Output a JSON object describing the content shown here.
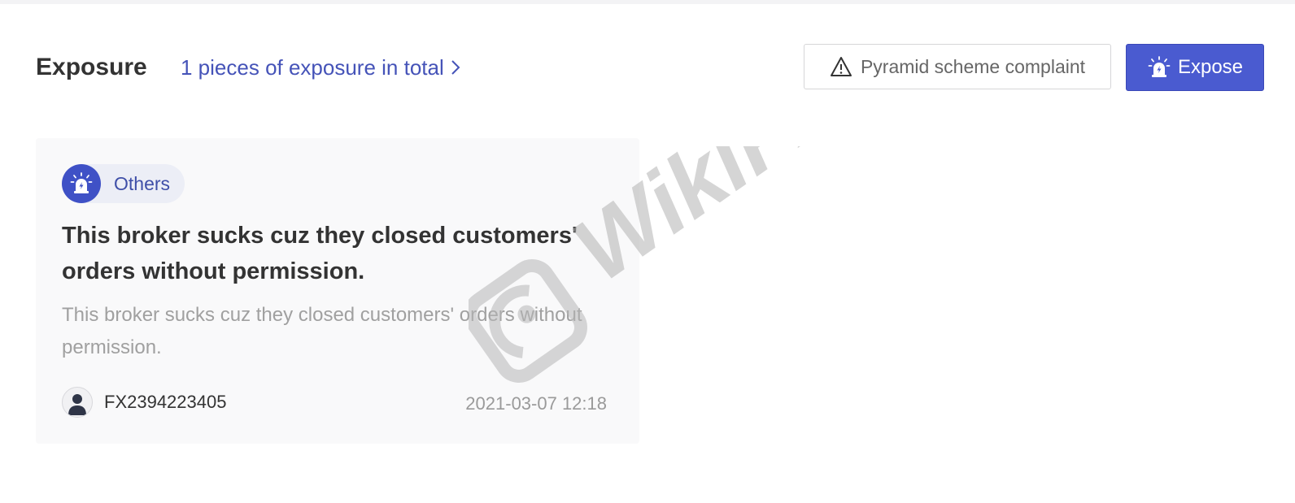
{
  "header": {
    "title": "Exposure",
    "total_link": "1 pieces of exposure in total",
    "complaint_button": "Pyramid scheme complaint",
    "expose_button": "Expose"
  },
  "card": {
    "tag": "Others",
    "title": "This broker sucks cuz they closed customers' orders without permission.",
    "description": "This broker sucks cuz they closed customers' orders without permission.",
    "author": "FX2394223405",
    "timestamp": "2021-03-07 12:18"
  },
  "watermark": {
    "text": "WikiFX"
  },
  "icons": {
    "chevron": "chevron-right-icon",
    "warning": "warning-triangle-icon",
    "alarm": "alarm-light-icon",
    "avatar": "user-avatar-icon"
  },
  "colors": {
    "accent": "#4a5bd0",
    "link": "#4553b8",
    "tag_bg": "#eceef6",
    "card_bg": "#f9f9fa"
  }
}
